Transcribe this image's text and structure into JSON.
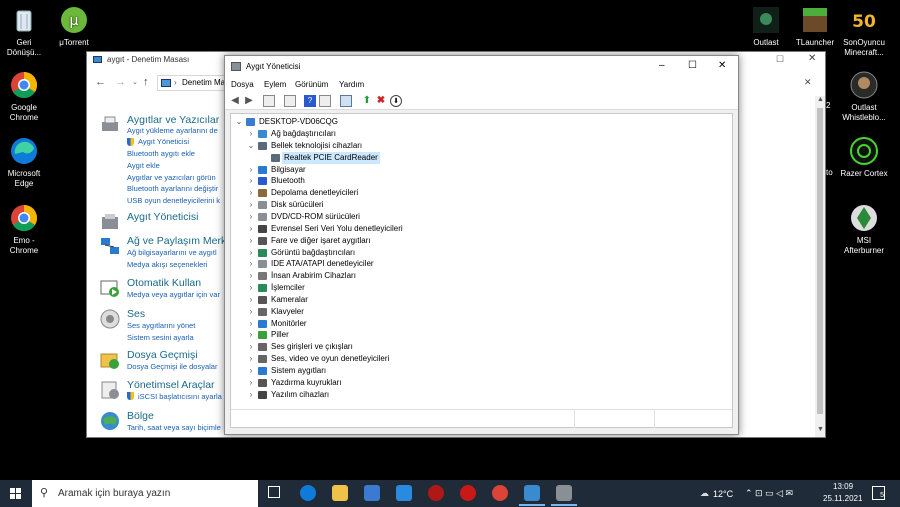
{
  "desktop": {
    "left_icons": [
      {
        "label": "Geri\nDönüşü...",
        "icon": "recycle-bin-icon"
      },
      {
        "label": "μTorrent",
        "icon": "utorrent-icon"
      },
      {
        "label": "Google\nChrome",
        "icon": "chrome-icon"
      },
      {
        "label": "Microsoft\nEdge",
        "icon": "edge-icon"
      },
      {
        "label": "Emo -\nChrome",
        "icon": "chrome-icon"
      }
    ],
    "right_icons": [
      {
        "label": "Outlast",
        "icon": "outlast-icon"
      },
      {
        "label": "TLauncher",
        "icon": "tlauncher-icon"
      },
      {
        "label": "SonOyuncu\nMinecraft...",
        "icon": "sonoyuncu-icon"
      },
      {
        "label": "Outlast\nWhistleblo...",
        "icon": "outlast-whistleblower-icon"
      },
      {
        "label": "Razer Cortex",
        "icon": "razer-cortex-icon"
      },
      {
        "label": "MSI\nAfterburner",
        "icon": "msi-afterburner-icon"
      }
    ],
    "partial_labels": [
      "2",
      "to"
    ]
  },
  "control_panel": {
    "title": "aygıt - Denetim Masası",
    "breadcrumb": "Denetim Ma",
    "categories": [
      {
        "title": "Aygıtlar ve Yazıcılar",
        "links": [
          "Aygıt yükleme ayarlarını de",
          "Aygıt Yöneticisi",
          "Bluetooth aygıtı ekle",
          "Aygıt ekle",
          "Aygıtlar ve yazıcıları görün",
          "Bluetooth ayarlarını değiştir",
          "USB oyun denetleyicilerini k"
        ]
      },
      {
        "title": "Aygıt Yöneticisi",
        "links": []
      },
      {
        "title": "Ağ ve Paylaşım Merke",
        "links": [
          "Ağ bilgisayarlarını ve aygıtl",
          "Medya akışı seçenekleri"
        ]
      },
      {
        "title": "Otomatik Kullan",
        "links": [
          "Medya veya aygıtlar için var"
        ]
      },
      {
        "title": "Ses",
        "links": [
          "Ses aygıtlarını yönet",
          "Sistem sesini ayarla"
        ]
      },
      {
        "title": "Dosya Geçmişi",
        "links": [
          "Dosya Geçmişi ile dosyalar"
        ]
      },
      {
        "title": "Yönetimsel Araçlar",
        "links": [
          "iSCSI başlatıcısını ayarla"
        ]
      },
      {
        "title": "Bölge",
        "links": [
          "Tarih, saat veya sayı biçimle"
        ]
      }
    ]
  },
  "device_manager": {
    "title": "Aygıt Yöneticisi",
    "menu": [
      "Dosya",
      "Eylem",
      "Görünüm",
      "Yardım"
    ],
    "root": "DESKTOP-VD06CQG",
    "nodes": [
      {
        "label": "Ağ bağdaştırıcıları",
        "expanded": false
      },
      {
        "label": "Bellek teknolojisi cihazları",
        "expanded": true
      },
      {
        "label": "Realtek PCIE CardReader",
        "child": true,
        "selected": true
      },
      {
        "label": "Bilgisayar",
        "expanded": false
      },
      {
        "label": "Bluetooth",
        "expanded": false
      },
      {
        "label": "Depolama denetleyicileri",
        "expanded": false
      },
      {
        "label": "Disk sürücüleri",
        "expanded": false
      },
      {
        "label": "DVD/CD-ROM sürücüleri",
        "expanded": false
      },
      {
        "label": "Evrensel Seri Veri Yolu denetleyicileri",
        "expanded": false
      },
      {
        "label": "Fare ve diğer işaret aygıtları",
        "expanded": false
      },
      {
        "label": "Görüntü bağdaştırıcıları",
        "expanded": false
      },
      {
        "label": "IDE ATA/ATAPI denetleyiciler",
        "expanded": false
      },
      {
        "label": "İnsan Arabirim Cihazları",
        "expanded": false
      },
      {
        "label": "İşlemciler",
        "expanded": false
      },
      {
        "label": "Kameralar",
        "expanded": false
      },
      {
        "label": "Klavyeler",
        "expanded": false
      },
      {
        "label": "Monitörler",
        "expanded": false
      },
      {
        "label": "Piller",
        "expanded": false
      },
      {
        "label": "Ses girişleri ve çıkışları",
        "expanded": false
      },
      {
        "label": "Ses, video ve oyun denetleyicileri",
        "expanded": false
      },
      {
        "label": "Sistem aygıtları",
        "expanded": false
      },
      {
        "label": "Yazdırma kuyrukları",
        "expanded": false
      },
      {
        "label": "Yazılım cihazları",
        "expanded": false
      }
    ]
  },
  "taskbar": {
    "search_placeholder": "Aramak için buraya yazın",
    "weather": "12°C",
    "time": "13:09",
    "date": "25.11.2021",
    "notifications": "5"
  },
  "colors": {
    "accent": "#0078d7",
    "taskbar": "#1f2b38",
    "link": "#1a5fb4",
    "heading": "#1a6a8a"
  }
}
